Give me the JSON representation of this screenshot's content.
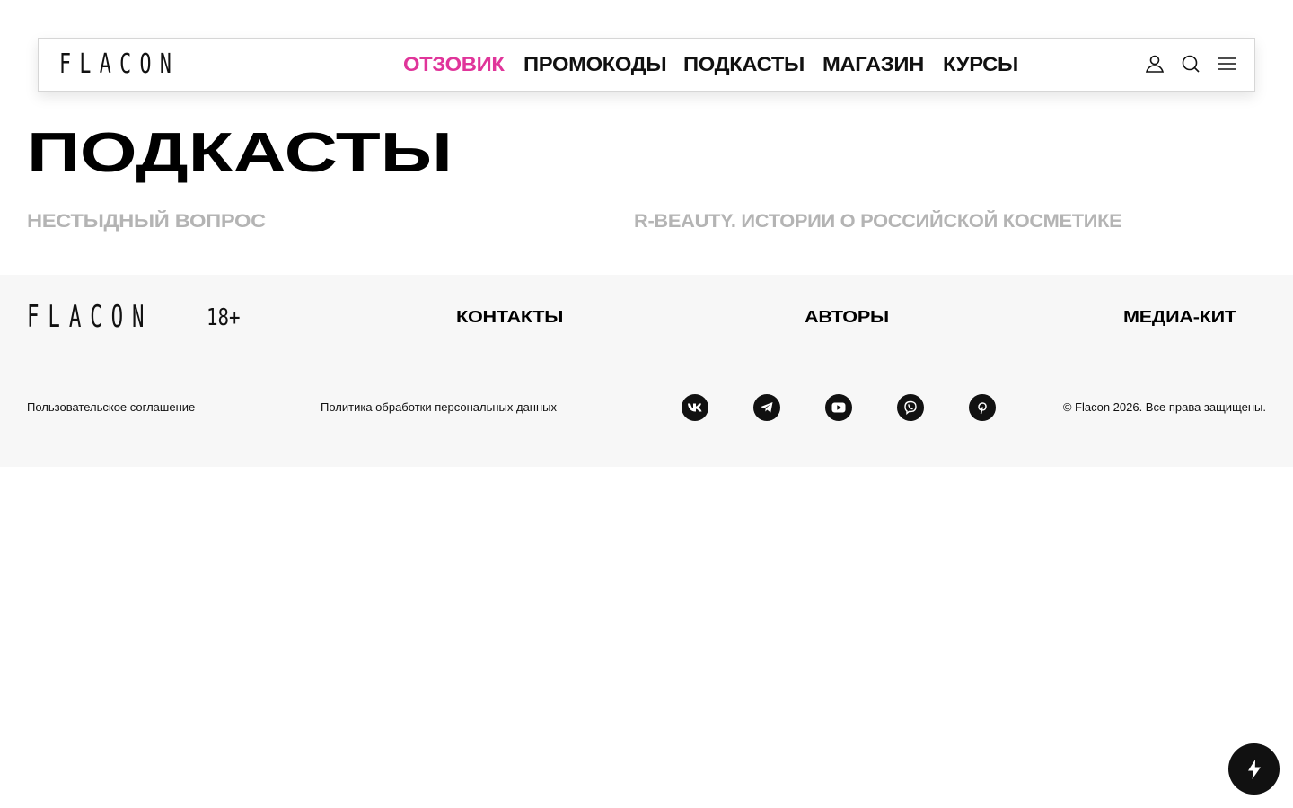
{
  "header": {
    "logo": "FLACON",
    "nav": [
      {
        "label": "ОТЗОВИК",
        "active": true
      },
      {
        "label": "ПРОМОКОДЫ",
        "active": false
      },
      {
        "label": "ПОДКАСТЫ",
        "active": false
      },
      {
        "label": "МАГАЗИН",
        "active": false
      },
      {
        "label": "КУРСЫ",
        "active": false
      }
    ],
    "icons": [
      "user-icon",
      "search-icon",
      "menu-icon"
    ],
    "accent_color": "#e0359a"
  },
  "main": {
    "title": "ПОДКАСТЫ",
    "podcasts": [
      {
        "label": "НЕСТЫДНЫЙ ВОПРОС"
      },
      {
        "label": "R-BEAUTY. ИСТОРИИ О РОССИЙСКОЙ КОСМЕТИКЕ"
      }
    ],
    "podcast_color": "#b4b4b4"
  },
  "footer": {
    "logo": "FLACON",
    "age": "18+",
    "links": [
      "КОНТАКТЫ",
      "АВТОРЫ",
      "МЕДИА-КИТ"
    ],
    "agreement": "Пользовательское соглашение",
    "privacy": "Политика обработки персональных данных",
    "socials": [
      "vk-icon",
      "telegram-icon",
      "youtube-icon",
      "viber-icon",
      "pinterest-icon"
    ],
    "copyright": "© Flacon 2026. Все права защищены."
  },
  "fab": {
    "icon": "lightning-icon"
  }
}
